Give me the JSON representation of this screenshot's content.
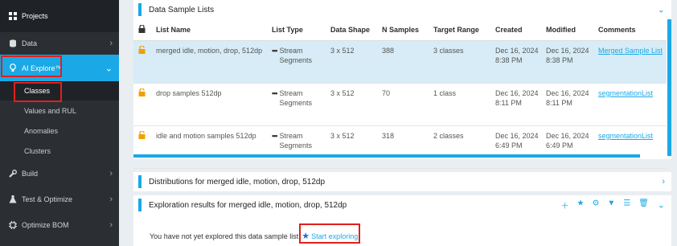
{
  "sidebar": {
    "projects": "Projects",
    "data": "Data",
    "ai_explore": "AI Explore™",
    "sub_items": [
      "Classes",
      "Values and RUL",
      "Anomalies",
      "Clusters"
    ],
    "build": "Build",
    "test": "Test & Optimize",
    "bom": "Optimize BOM"
  },
  "lists_panel": {
    "title": "Data Sample Lists",
    "columns": [
      "List Name",
      "List Type",
      "Data Shape",
      "N Samples",
      "Target Range",
      "Created",
      "Modified",
      "Comments"
    ],
    "rows": [
      {
        "name": "merged idle, motion, drop, 512dp",
        "type": "Stream Segments",
        "shape": "3 x 512",
        "n": "388",
        "target": "3 classes",
        "created": "Dec 16, 2024 8:38 PM",
        "modified": "Dec 16, 2024 8:38 PM",
        "comment": "Merged Sample List"
      },
      {
        "name": "drop samples 512dp",
        "type": "Stream Segments",
        "shape": "3 x 512",
        "n": "70",
        "target": "1 class",
        "created": "Dec 16, 2024 8:11 PM",
        "modified": "Dec 16, 2024 8:11 PM",
        "comment": "segmentationList"
      },
      {
        "name": "idle and motion samples 512dp",
        "type": "Stream Segments",
        "shape": "3 x 512",
        "n": "318",
        "target": "2 classes",
        "created": "Dec 16, 2024 6:49 PM",
        "modified": "Dec 16, 2024 6:49 PM",
        "comment": "segmentationList"
      }
    ]
  },
  "dist_panel": {
    "title": "Distributions for merged idle, motion, drop, 512dp"
  },
  "explore_panel": {
    "title": "Exploration results for merged idle, motion, drop, 512dp",
    "empty_message": "You have not yet explored this data sample list",
    "start_label": "Start exploring"
  },
  "icons": {
    "projects": "grid-icon",
    "data": "database-icon",
    "ai_explore": "lightbulb-icon",
    "build": "wrench-icon",
    "test": "flask-icon",
    "bom": "chip-icon",
    "lock": "lock-icon"
  },
  "colors": {
    "accent": "#1aa9e6",
    "sidebar": "#2b2f33",
    "selected_row": "#d7ecf6",
    "highlight_box": "#e0201c",
    "lock": "#f0a000"
  }
}
